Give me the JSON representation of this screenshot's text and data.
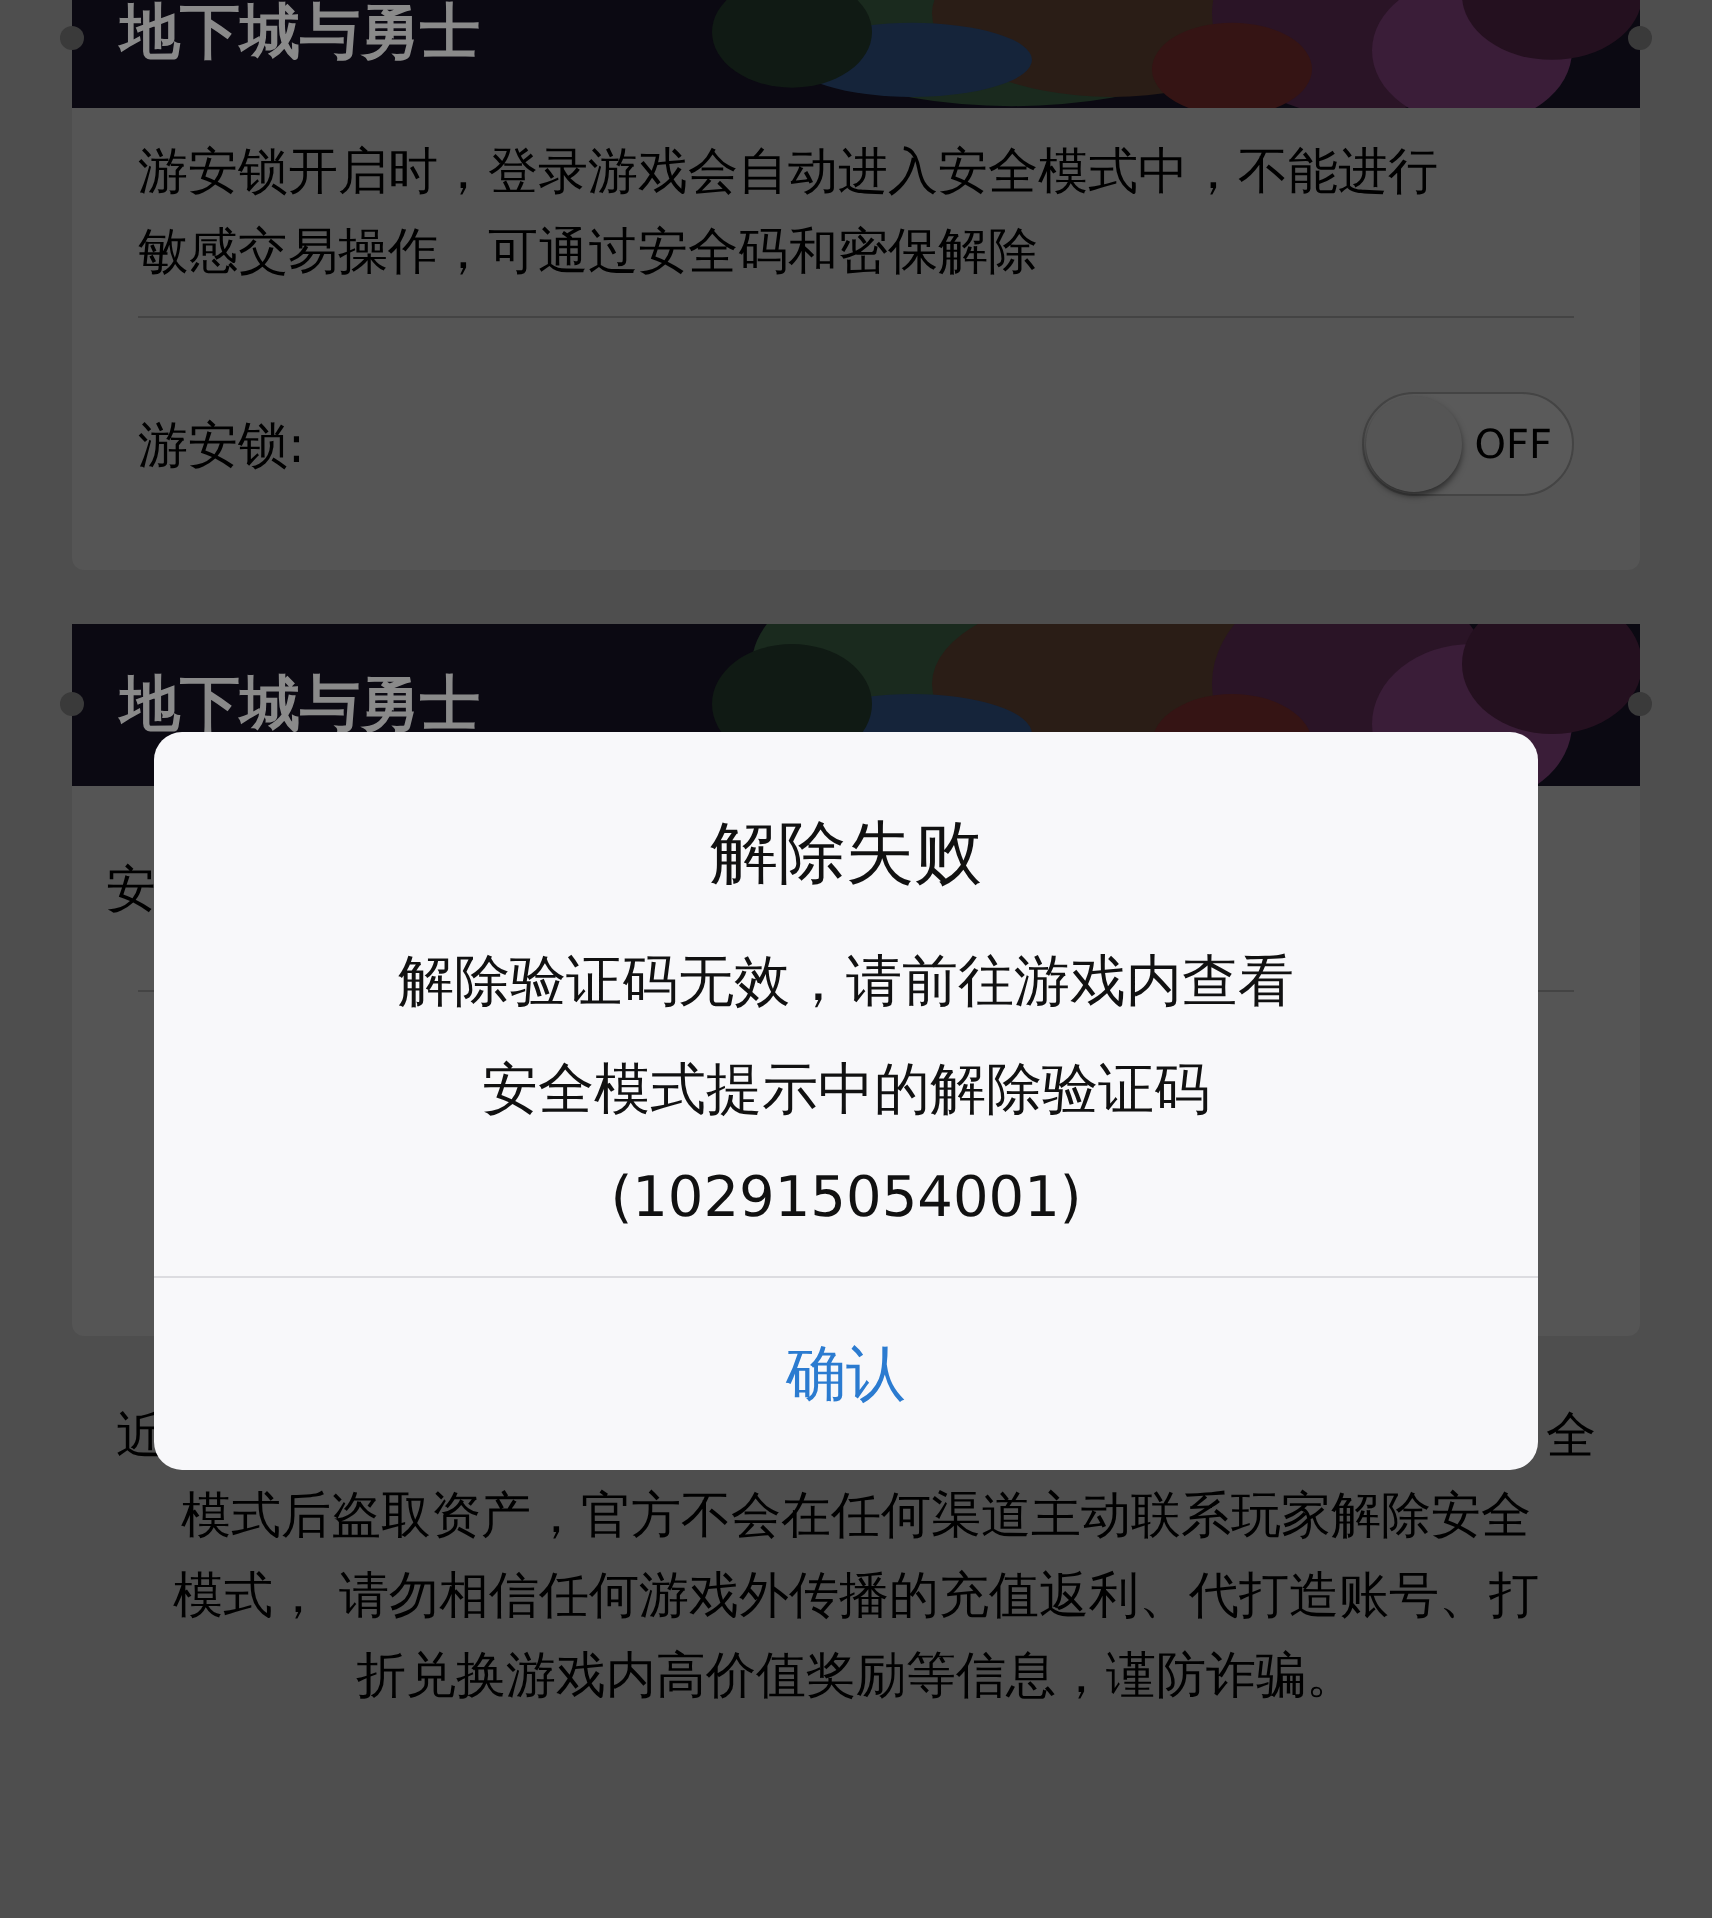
{
  "cards": [
    {
      "banner_title": "地下城与勇士",
      "description_lines": [
        "游安锁开启时，登录游戏会自动进入安全模式中，不能进行",
        "敏感交易操作，可通过安全码和密保解除"
      ],
      "setting": {
        "label": "游安锁:",
        "toggle_label": "OFF",
        "on": false
      }
    },
    {
      "banner_title": "地下城与勇士",
      "row_fragment": "安"
    }
  ],
  "notice": {
    "first_line_start": "近",
    "first_line_end": "全",
    "lines": [
      "模式后盗取资产，官方不会在任何渠道主动联系玩家解除安全",
      "模式， 请勿相信任何游戏外传播的充值返利、代打造账号、打",
      "折兑换游戏内高价值奖励等信息，谨防诈骗。"
    ]
  },
  "dialog": {
    "title": "解除失败",
    "message_lines": [
      "解除验证码无效，请前往游戏内查看",
      "安全模式提示中的解除验证码",
      "(102915054001)"
    ],
    "buttons": [
      "确认"
    ]
  }
}
